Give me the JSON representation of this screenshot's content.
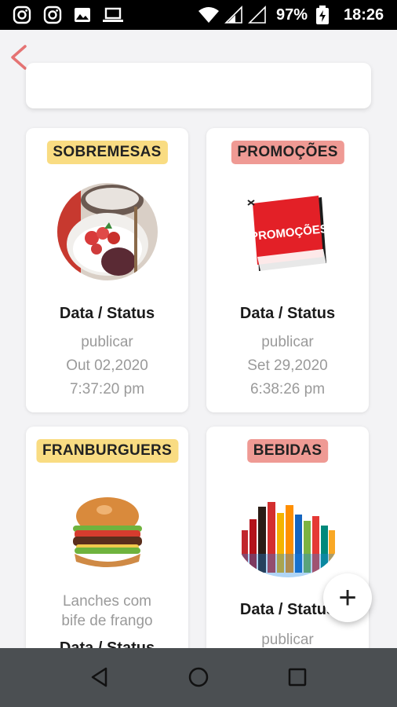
{
  "status_bar": {
    "battery": "97%",
    "time": "18:26",
    "icons": [
      "instagram-icon",
      "instagram-icon",
      "image-icon",
      "laptop-icon",
      "wifi-icon",
      "signal-icon",
      "signal-empty-icon",
      "battery-charging-icon"
    ]
  },
  "appbar": {
    "back_icon": "chevron-left-icon",
    "accent": "#e57373"
  },
  "cards": [
    {
      "tag": "SOBREMESAS",
      "tag_color": "#f9dc82",
      "image": "dessert-image",
      "title": "Data / Status",
      "status": "publicar",
      "date": "Out 02,2020",
      "time": "7:37:20 pm"
    },
    {
      "tag": "PROMOÇÕES",
      "tag_color": "#ef9a94",
      "image": "promo-banner-image",
      "banner_text": "PROMOÇÕES",
      "title": "Data / Status",
      "status": "publicar",
      "date": "Set 29,2020",
      "time": "6:38:26 pm"
    },
    {
      "tag": "FRANBURGUERS",
      "tag_color": "#f9dc82",
      "image": "burger-image",
      "desc_line1": "Lanches com",
      "desc_line2": "bife de frango",
      "title": "Data / Status"
    },
    {
      "tag": "BEBIDAS",
      "tag_color": "#ef9a94",
      "image": "drinks-image",
      "title": "Data / Status",
      "status": "publicar"
    }
  ],
  "fab": {
    "label": "+"
  },
  "navbar": {
    "icons": [
      "back-triangle-icon",
      "home-circle-icon",
      "recents-square-icon"
    ]
  }
}
